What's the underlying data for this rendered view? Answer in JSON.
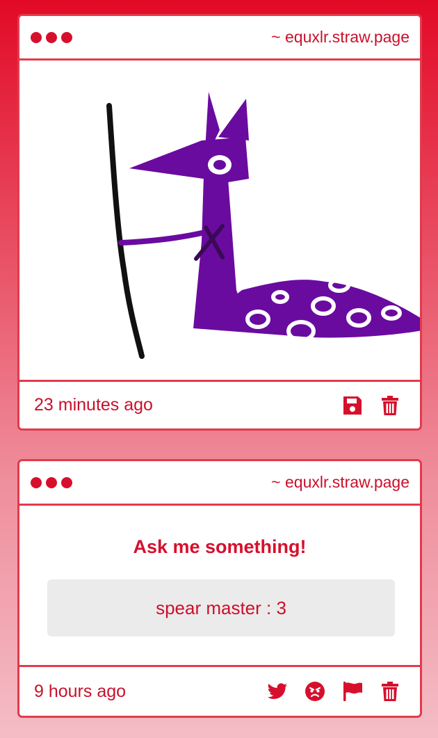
{
  "colors": {
    "accent": "#d6102c",
    "border": "#e23a4c",
    "answer_bg": "#ecebec",
    "drawing_purple": "#6a0ba0"
  },
  "posts": [
    {
      "site": "~ equxlr.straw.page",
      "timestamp": "23 minutes ago",
      "actions": [
        "save-icon",
        "trash-icon"
      ]
    },
    {
      "site": "~ equxlr.straw.page",
      "ask_title": "Ask me something!",
      "answer": "spear master : 3",
      "timestamp": "9 hours ago",
      "actions": [
        "twitter-icon",
        "angry-face-icon",
        "flag-icon",
        "trash-icon"
      ]
    }
  ]
}
